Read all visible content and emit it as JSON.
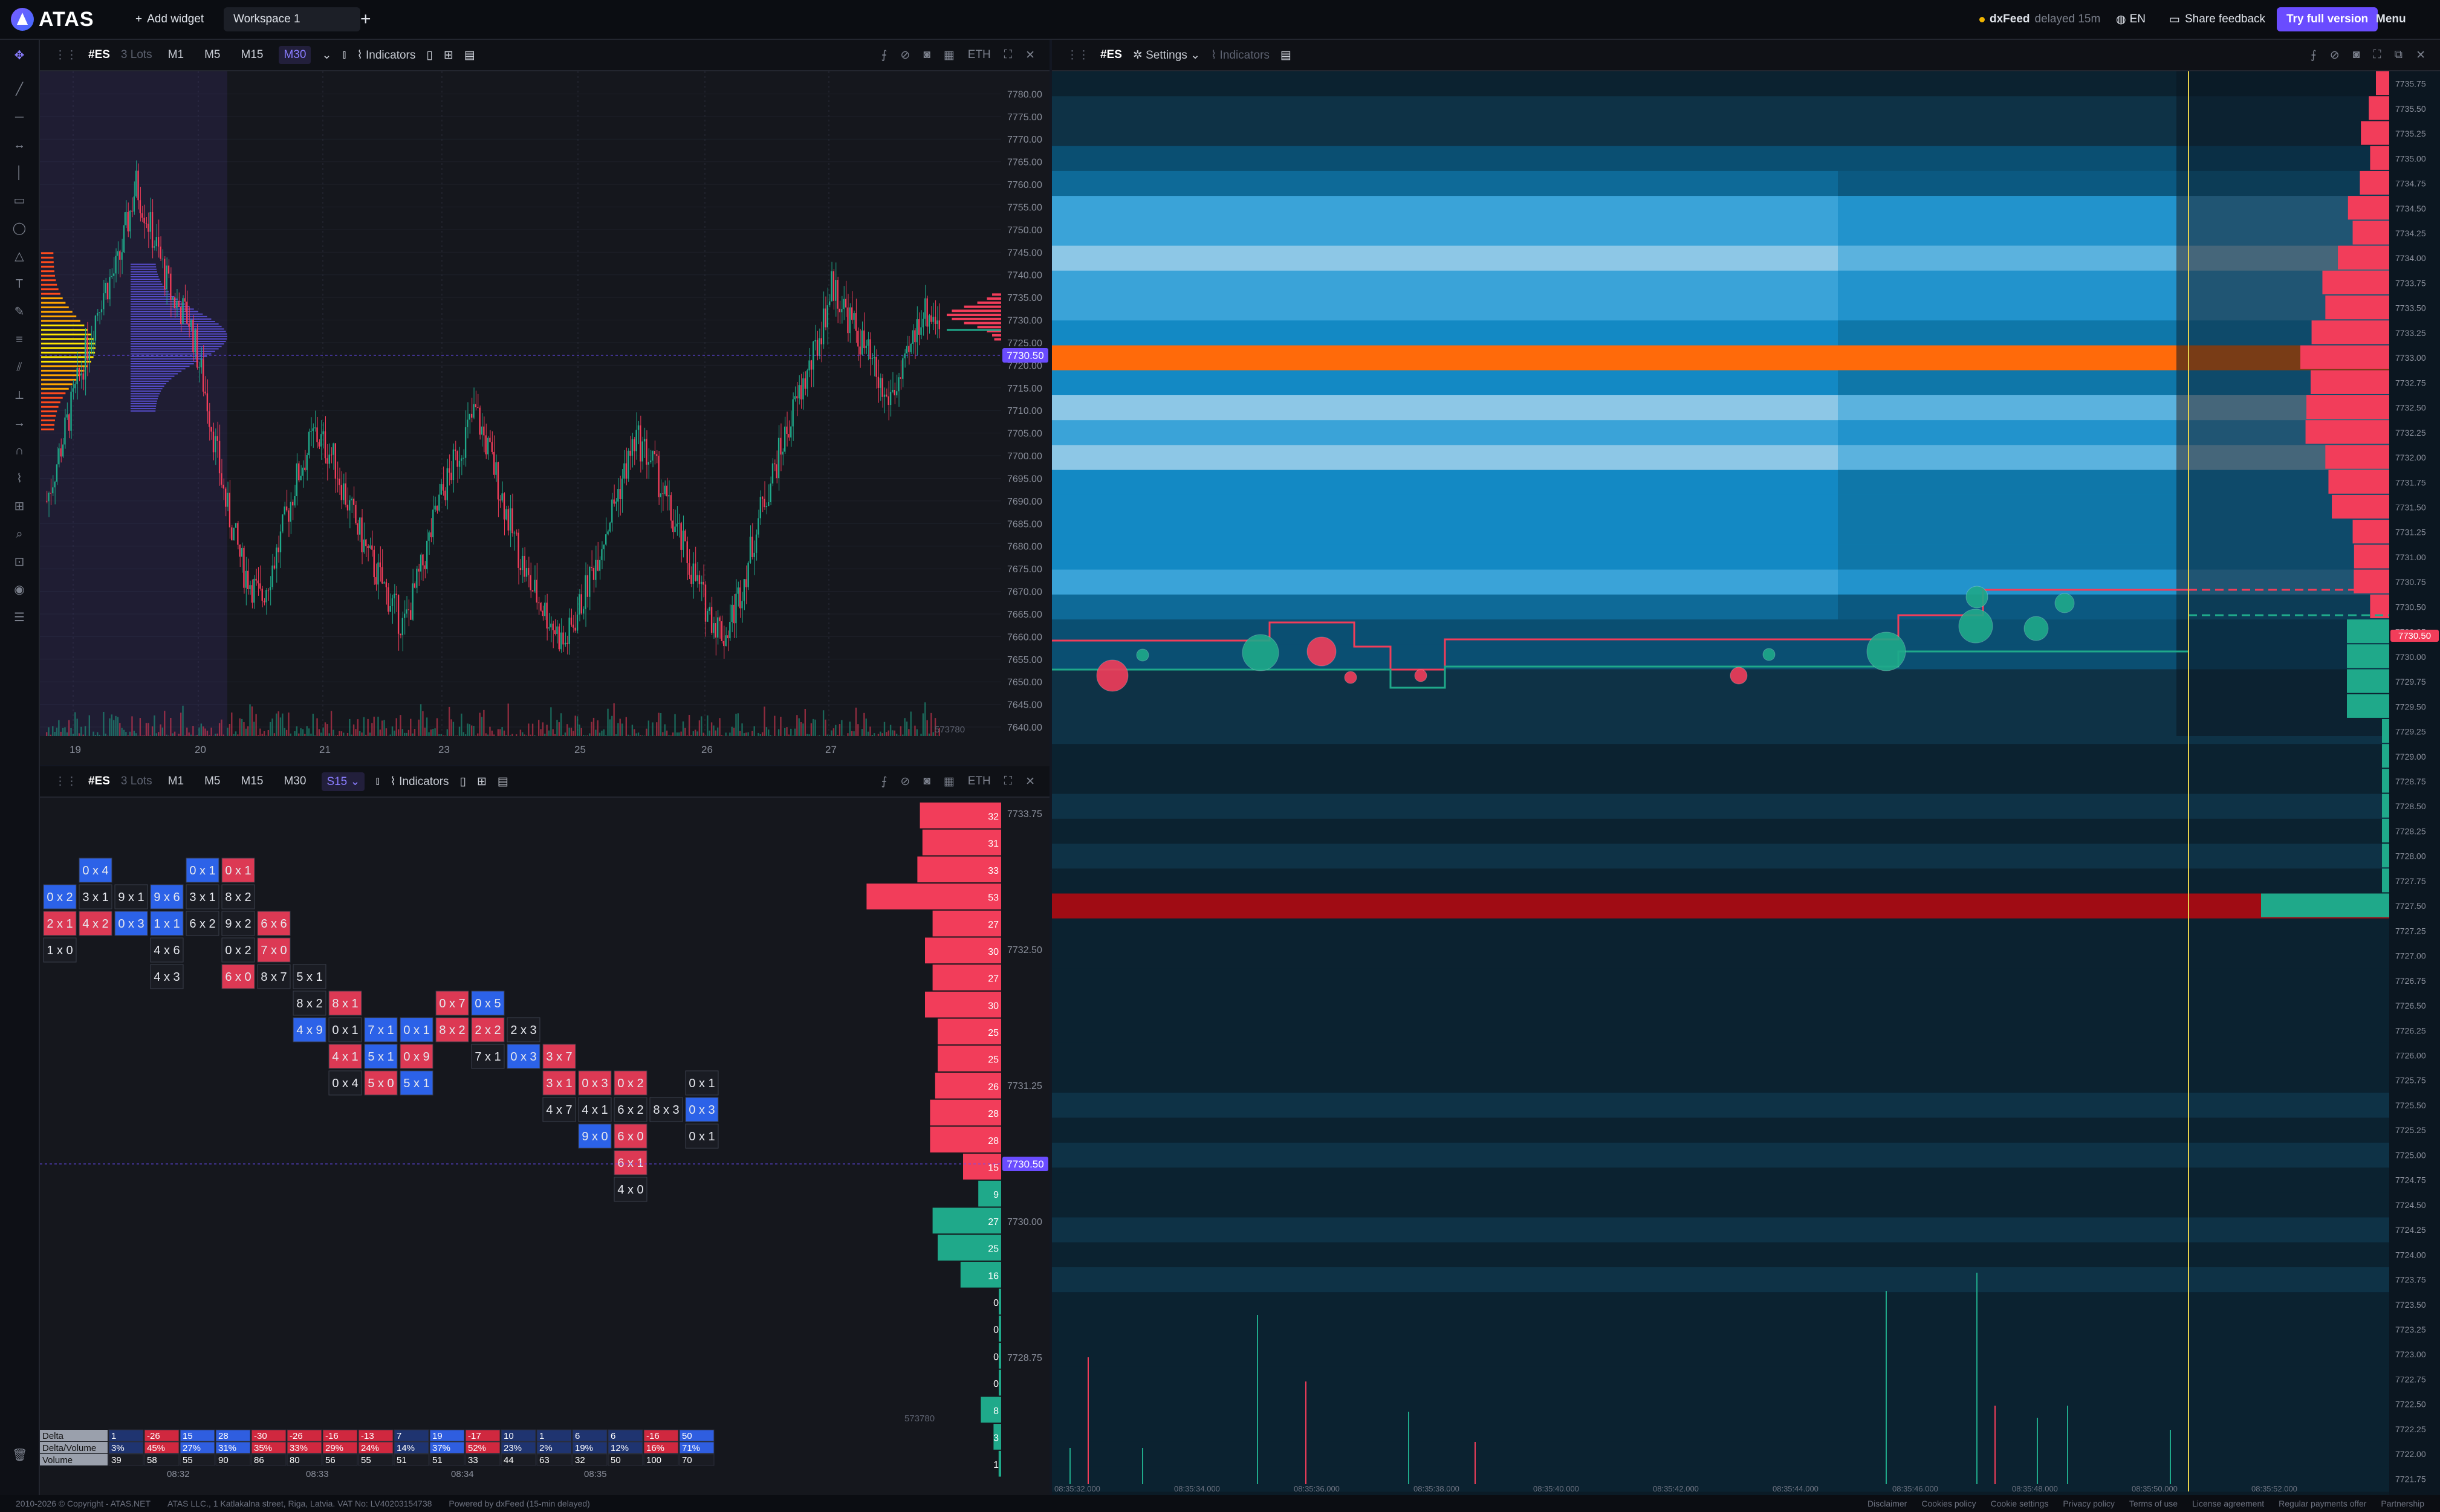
{
  "app": {
    "logo": "ATAS",
    "add_widget": "Add widget",
    "workspace_tab": "Workspace 1",
    "feed": "dxFeed",
    "feed_status": "delayed 15m",
    "lang": "EN",
    "feedback": "Share feedback",
    "try": "Try full version",
    "menu": "Menu"
  },
  "colors": {
    "accent": "#6a4cff",
    "buy": "#1fa98a",
    "sell": "#f23d5a",
    "price_tag": "#6a4cff"
  },
  "chart1": {
    "symbol": "#ES",
    "lots": "3 Lots",
    "timeframes": [
      "M1",
      "M5",
      "M15",
      "M30"
    ],
    "active_tf": "M30",
    "indicators": "Indicators",
    "eth": "ETH",
    "current_price": "7730.50",
    "volume_label": "573780",
    "chart_data": {
      "type": "candlestick",
      "x_ticks": [
        "19",
        "20",
        "21",
        "23",
        "25",
        "26",
        "27"
      ],
      "y_ticks": [
        "7780.00",
        "7775.00",
        "7770.00",
        "7765.00",
        "7760.00",
        "7755.00",
        "7750.00",
        "7745.00",
        "7740.00",
        "7735.00",
        "7730.00",
        "7725.00",
        "7720.00",
        "7715.00",
        "7710.00",
        "7705.00",
        "7700.00",
        "7695.00",
        "7690.00",
        "7685.00",
        "7680.00",
        "7675.00",
        "7670.00",
        "7665.00",
        "7660.00",
        "7655.00",
        "7650.00",
        "7645.00",
        "7640.00"
      ],
      "ylim": [
        7638,
        7785
      ],
      "close_path": [
        7690,
        7705,
        7720,
        7735,
        7742,
        7760,
        7748,
        7735,
        7730,
        7712,
        7690,
        7675,
        7668,
        7680,
        7695,
        7705,
        7700,
        7688,
        7678,
        7670,
        7662,
        7675,
        7690,
        7700,
        7710,
        7698,
        7684,
        7672,
        7665,
        7658,
        7668,
        7680,
        7692,
        7704,
        7698,
        7686,
        7676,
        7666,
        7660,
        7672,
        7688,
        7700,
        7712,
        7722,
        7738,
        7730,
        7722,
        7712,
        7718,
        7732,
        7730.5
      ]
    }
  },
  "chart2": {
    "symbol": "#ES",
    "lots": "3 Lots",
    "timeframes": [
      "M1",
      "M5",
      "M15",
      "M30",
      "S15"
    ],
    "active_tf": "S15",
    "indicators": "Indicators",
    "eth": "ETH",
    "current_price": "7730.50",
    "volume_label": "573780",
    "y_ticks": [
      "7733.75",
      "7732.50",
      "7731.25",
      "7730.00",
      "7728.75"
    ],
    "profile_values": [
      "32",
      "31",
      "33",
      "53",
      "27",
      "30",
      "27",
      "30",
      "25",
      "25",
      "26",
      "28",
      "28",
      "15",
      "9",
      "27",
      "25",
      "16",
      "0",
      "0",
      "0",
      "0",
      "8",
      "3",
      "1"
    ],
    "footprint_columns": [
      {
        "cells": [
          "0 x 2",
          "2 x 1",
          "1 x 0"
        ]
      },
      {
        "cells": [
          "0 x 4",
          "3 x 1",
          "4 x 2"
        ]
      },
      {
        "cells": [
          "9 x 1",
          "0 x 3"
        ]
      },
      {
        "cells": [
          "9 x 6",
          "1 x 1",
          "4 x 6",
          "4 x 3"
        ]
      },
      {
        "cells": [
          "0 x 1",
          "3 x 1",
          "6 x 2"
        ]
      },
      {
        "cells": [
          "0 x 1",
          "8 x 2",
          "9 x 2",
          "0 x 2",
          "6 x 0"
        ]
      },
      {
        "cells": [
          "6 x 6",
          "7 x 0",
          "8 x 7"
        ]
      },
      {
        "cells": [
          "5 x 1",
          "8 x 2",
          "4 x 9"
        ]
      },
      {
        "cells": [
          "8 x 1",
          "0 x 1",
          "4 x 1",
          "0 x 4"
        ]
      },
      {
        "cells": [
          "7 x 1",
          "5 x 1",
          "5 x 0"
        ]
      },
      {
        "cells": [
          "0 x 1",
          "0 x 9",
          "5 x 1"
        ]
      },
      {
        "cells": [
          "0 x 7",
          "8 x 2"
        ]
      },
      {
        "cells": [
          "0 x 5",
          "2 x 2",
          "7 x 1"
        ]
      },
      {
        "cells": [
          "2 x 3",
          "0 x 3"
        ]
      },
      {
        "cells": [
          "3 x 7",
          "3 x 1",
          "4 x 7"
        ]
      },
      {
        "cells": [
          "0 x 3",
          "4 x 1",
          "9 x 0"
        ]
      },
      {
        "cells": [
          "0 x 2",
          "6 x 2",
          "6 x 0",
          "6 x 1",
          "4 x 0"
        ]
      },
      {
        "cells": [
          "8 x 3"
        ]
      },
      {
        "cells": [
          "0 x 1",
          "0 x 3",
          "0 x 1"
        ]
      }
    ],
    "stats": {
      "labels": [
        "Delta",
        "Delta/Volume",
        "Volume"
      ],
      "delta": [
        "1",
        "-26",
        "15",
        "28",
        "-30",
        "-26",
        "-16",
        "-13",
        "7",
        "19",
        "-17",
        "10",
        "1",
        "6",
        "6",
        "-16",
        "50"
      ],
      "delta_volume": [
        "3%",
        "45%",
        "27%",
        "31%",
        "35%",
        "33%",
        "29%",
        "24%",
        "14%",
        "37%",
        "52%",
        "23%",
        "2%",
        "19%",
        "12%",
        "16%",
        "71%"
      ],
      "volume": [
        "39",
        "58",
        "55",
        "90",
        "86",
        "80",
        "56",
        "55",
        "51",
        "51",
        "33",
        "44",
        "63",
        "32",
        "50",
        "100",
        "70"
      ],
      "time_ticks": [
        "08:32",
        "08:33",
        "08:34",
        "08:35"
      ]
    }
  },
  "heatmap": {
    "symbol": "#ES",
    "settings": "Settings",
    "indicators": "Indicators",
    "current_price": "7730.50",
    "y_ticks": [
      "7735.75",
      "7735.50",
      "7735.25",
      "7735.00",
      "7734.75",
      "7734.50",
      "7734.25",
      "7734.00",
      "7733.75",
      "7733.50",
      "7733.25",
      "7733.00",
      "7732.75",
      "7732.50",
      "7732.25",
      "7732.00",
      "7731.75",
      "7731.50",
      "7731.25",
      "7731.00",
      "7730.75",
      "7730.50",
      "7730.25",
      "7730.00",
      "7729.75",
      "7729.50",
      "7729.25",
      "7729.00",
      "7728.75",
      "7728.50",
      "7728.25",
      "7728.00",
      "7727.75",
      "7727.50",
      "7727.25",
      "7727.00",
      "7726.75",
      "7726.50",
      "7726.25",
      "7726.00",
      "7725.75",
      "7725.50",
      "7725.25",
      "7725.00",
      "7724.75",
      "7724.50",
      "7724.25",
      "7724.00",
      "7723.75",
      "7723.50",
      "7723.25",
      "7723.00",
      "7722.75",
      "7722.50",
      "7722.25",
      "7722.00",
      "7721.75"
    ],
    "time_ticks": [
      "08:35:32.000",
      "08:35:34.000",
      "08:35:36.000",
      "08:35:38.000",
      "08:35:40.000",
      "08:35:42.000",
      "08:35:44.000",
      "08:35:46.000",
      "08:35:48.000",
      "08:35:50.000",
      "08:35:52.000"
    ]
  },
  "footer": {
    "copyright": "2010-2026 © Copyright - ATAS.NET",
    "company": "ATAS LLC., 1 Katlakalna street, Riga, Latvia. VAT No: LV40203154738",
    "powered": "Powered by dxFeed (15-min delayed)",
    "links": [
      "Disclaimer",
      "Cookies policy",
      "Cookie settings",
      "Privacy policy",
      "Terms of use",
      "License agreement",
      "Regular payments offer",
      "Partnership"
    ]
  }
}
